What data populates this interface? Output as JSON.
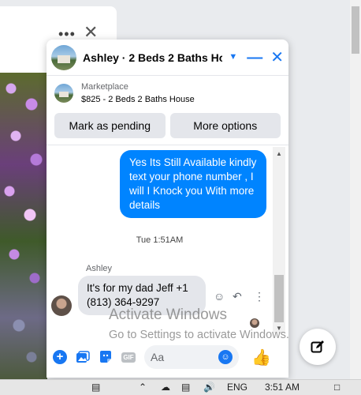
{
  "background": {
    "more_glyph": "•••",
    "close_glyph": "✕"
  },
  "chat": {
    "title": "Ashley · 2 Beds 2 Baths Ho...",
    "listing": {
      "label": "Marketplace",
      "title": "$825 - 2 Beds 2 Baths House"
    },
    "actions": {
      "mark_pending": "Mark as pending",
      "more_options": "More options"
    },
    "messages": {
      "outgoing": "Yes Its Still Available kindly text your phone number , I will I Knock you With more details",
      "timestamp": "Tue 1:51AM",
      "sender_name": "Ashley",
      "incoming": "It's for my dad Jeff +1 (813) 364-9297"
    },
    "composer": {
      "placeholder": "Aa",
      "gif_label": "GIF"
    },
    "colors": {
      "accent": "#1877f2",
      "outgoing_bubble": "#0084ff",
      "incoming_bubble": "#e4e6eb"
    }
  },
  "watermark": {
    "title": "Activate Windows",
    "subtitle": "Go to Settings to activate Windows."
  },
  "taskbar": {
    "language": "ENG",
    "time": "3:51 AM"
  },
  "icons": [
    "more-icon",
    "close-icon",
    "chevron-down-icon",
    "minimize-icon",
    "emoji-reaction-icon",
    "reply-icon",
    "more-vertical-icon",
    "plus-icon",
    "image-icon",
    "sticker-icon",
    "gif-icon",
    "emoji-icon",
    "like-icon",
    "compose-icon",
    "network-icon",
    "volume-icon",
    "notification-icon"
  ]
}
